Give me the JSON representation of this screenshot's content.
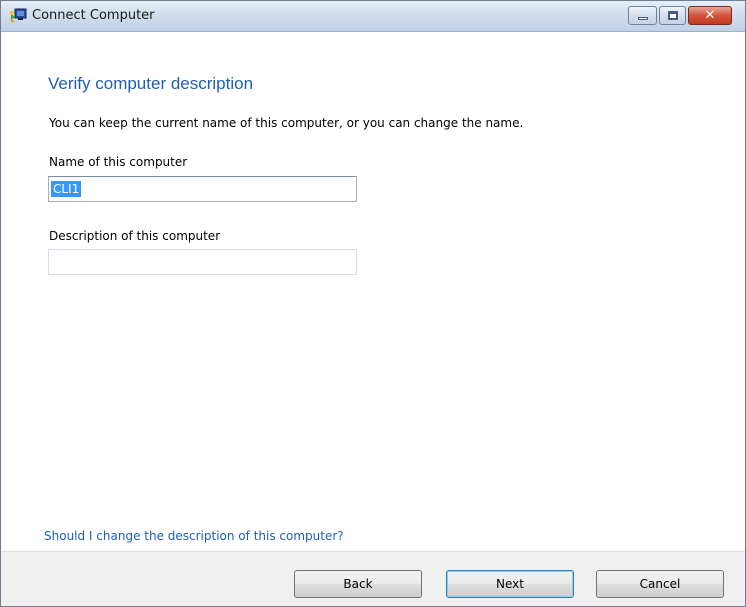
{
  "window": {
    "title": "Connect Computer",
    "icon": "network-computer-icon",
    "close_glyph": "✕"
  },
  "page": {
    "heading": "Verify computer description",
    "instruction": "You can keep the current name of this computer, or you can change the name."
  },
  "fields": {
    "name_label": "Name of this computer",
    "name_value": "CLI1",
    "description_label": "Description of this computer",
    "description_value": ""
  },
  "help_link": "Should I change the description of this computer?",
  "buttons": {
    "back": "Back",
    "next": "Next",
    "cancel": "Cancel"
  },
  "colors": {
    "heading": "#1e5fb5",
    "link": "#1e5fb5",
    "selection": "#3399ff"
  }
}
